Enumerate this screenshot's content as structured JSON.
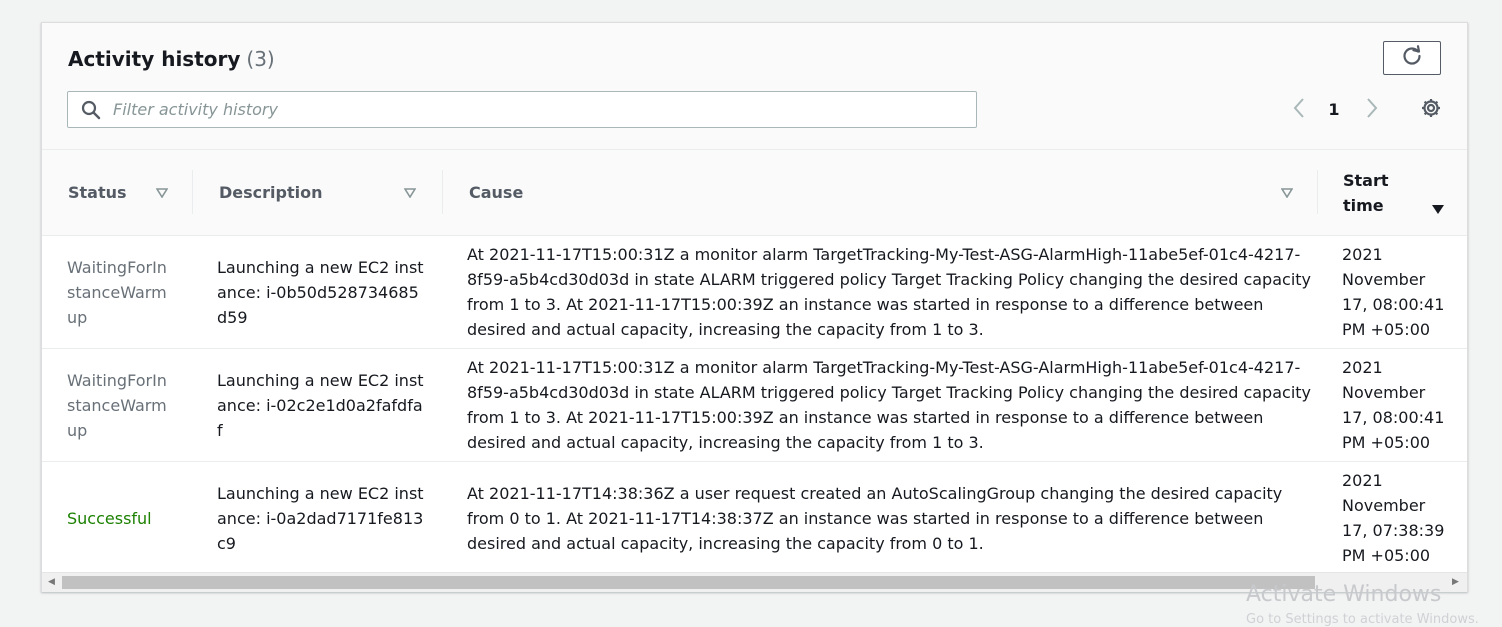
{
  "header": {
    "title": "Activity history",
    "count": "(3)",
    "search_placeholder": "Filter activity history",
    "page_number": "1"
  },
  "columns": [
    "Status",
    "Description",
    "Cause",
    "Start\ntime"
  ],
  "rows": [
    {
      "status": "WaitingForInstanceWarmup",
      "description": "Launching a new EC2 instance: i-0b50d528734685d59",
      "cause": "At 2021-11-17T15:00:31Z a monitor alarm TargetTracking-My-Test-ASG-AlarmHigh-11abe5ef-01c4-4217-8f59-a5b4cd30d03d in state ALARM triggered policy Target Tracking Policy changing the desired capacity from 1 to 3. At 2021-11-17T15:00:39Z an instance was started in response to a difference between desired and actual capacity, increasing the capacity from 1 to 3.",
      "start_time": "2021 November 17, 08:00:41 PM +05:00"
    },
    {
      "status": "WaitingForInstanceWarmup",
      "description": "Launching a new EC2 instance: i-02c2e1d0a2fafdfaf",
      "cause": "At 2021-11-17T15:00:31Z a monitor alarm TargetTracking-My-Test-ASG-AlarmHigh-11abe5ef-01c4-4217-8f59-a5b4cd30d03d in state ALARM triggered policy Target Tracking Policy changing the desired capacity from 1 to 3. At 2021-11-17T15:00:39Z an instance was started in response to a difference between desired and actual capacity, increasing the capacity from 1 to 3.",
      "start_time": "2021 November 17, 08:00:41 PM +05:00"
    },
    {
      "status": "Successful",
      "description": "Launching a new EC2 instance: i-0a2dad7171fe813c9",
      "cause": "At 2021-11-17T14:38:36Z a user request created an AutoScalingGroup changing the desired capacity from 0 to 1. At 2021-11-17T14:38:37Z an instance was started in response to a difference between desired and actual capacity, increasing the capacity from 0 to 1.",
      "start_time": "2021 November 17, 07:38:39 PM +05:00"
    }
  ],
  "watermark": {
    "title": "Activate Windows",
    "subtitle": "Go to Settings to activate Windows."
  },
  "colors": {
    "success": "#1d8102",
    "pending": "#687078",
    "header_text": "#545b64"
  },
  "icons": [
    "search-icon",
    "refresh-icon",
    "chevron-left-icon",
    "chevron-right-icon",
    "gear-icon",
    "sort-icon",
    "sort-desc-icon"
  ]
}
